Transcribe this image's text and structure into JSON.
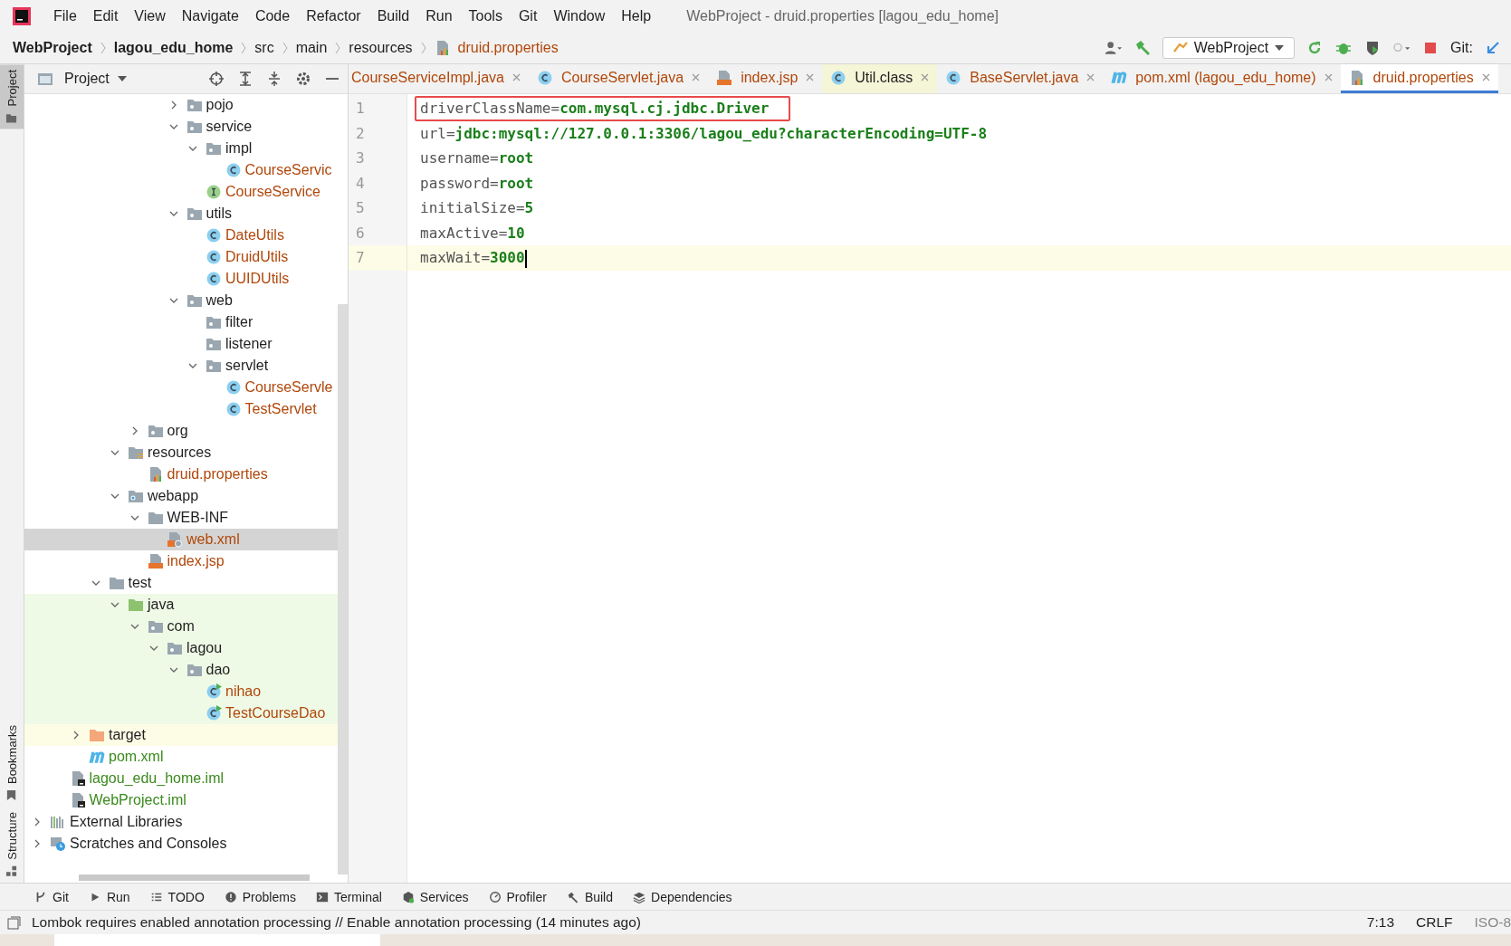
{
  "menu": [
    "File",
    "Edit",
    "View",
    "Navigate",
    "Code",
    "Refactor",
    "Build",
    "Run",
    "Tools",
    "Git",
    "Window",
    "Help"
  ],
  "window": {
    "title": "WebProject - druid.properties [lagou_edu_home]"
  },
  "breadcrumbs": [
    {
      "label": "WebProject",
      "bold": true
    },
    {
      "label": "lagou_edu_home",
      "bold": true
    },
    {
      "label": "src",
      "bold": false
    },
    {
      "label": "main",
      "bold": false
    },
    {
      "label": "resources",
      "bold": false
    },
    {
      "label": "druid.properties",
      "bold": false,
      "kind": "properties",
      "color": "#b0470a"
    }
  ],
  "toolbar": {
    "run_config": "WebProject",
    "git_label": "Git:"
  },
  "side_tabs": [
    {
      "label": "Project",
      "selected": true
    },
    {
      "label": "Bookmarks",
      "selected": false
    },
    {
      "label": "Structure",
      "selected": false
    }
  ],
  "project_panel": {
    "title": "Project"
  },
  "tree": [
    {
      "label": "pojo",
      "kind": "package",
      "expanded": false,
      "selected": false
    },
    {
      "label": "service",
      "kind": "package",
      "expanded": true,
      "selected": false,
      "children": [
        {
          "label": "impl",
          "kind": "package",
          "expanded": true,
          "selected": false,
          "children": [
            {
              "label": "CourseServic",
              "kind": "class",
              "color": "#b0470a",
              "selected": false
            }
          ]
        },
        {
          "label": "CourseService",
          "kind": "interface",
          "color": "#b0470a",
          "selected": false
        }
      ]
    },
    {
      "label": "utils",
      "kind": "package",
      "expanded": true,
      "selected": false,
      "children": [
        {
          "label": "DateUtils",
          "kind": "class",
          "color": "#b0470a",
          "selected": false
        },
        {
          "label": "DruidUtils",
          "kind": "class",
          "color": "#b0470a",
          "selected": false
        },
        {
          "label": "UUIDUtils",
          "kind": "class",
          "color": "#b0470a",
          "selected": false
        }
      ]
    },
    {
      "label": "web",
      "kind": "package",
      "expanded": true,
      "selected": false,
      "children": [
        {
          "label": "filter",
          "kind": "package",
          "selected": false
        },
        {
          "label": "listener",
          "kind": "package",
          "selected": false
        },
        {
          "label": "servlet",
          "kind": "package",
          "expanded": true,
          "selected": false,
          "children": [
            {
              "label": "CourseServle",
              "kind": "class",
              "color": "#b0470a",
              "selected": false
            },
            {
              "label": "TestServlet",
              "kind": "class",
              "color": "#b0470a",
              "selected": false
            }
          ]
        }
      ]
    },
    {
      "label": "org",
      "kind": "package",
      "expanded": false,
      "selected": false
    },
    {
      "label": "resources",
      "kind": "resources",
      "expanded": true,
      "selected": false,
      "children": [
        {
          "label": "druid.properties",
          "kind": "properties",
          "color": "#b0470a",
          "selected": false
        }
      ]
    },
    {
      "label": "webapp",
      "kind": "webapp",
      "expanded": true,
      "selected": false,
      "children": [
        {
          "label": "WEB-INF",
          "kind": "folder",
          "expanded": true,
          "selected": false,
          "children": [
            {
              "label": "web.xml",
              "kind": "xml",
              "color": "#b0470a",
              "selected": true
            }
          ]
        },
        {
          "label": "index.jsp",
          "kind": "jsp",
          "color": "#b0470a",
          "selected": false
        }
      ]
    },
    {
      "label": "test",
      "kind": "folder",
      "expanded": true,
      "selected": false,
      "children": [
        {
          "label": "java",
          "kind": "test-folder",
          "expanded": true,
          "selected": false,
          "test_sources": true,
          "children": [
            {
              "label": "com",
              "kind": "package",
              "expanded": true,
              "selected": false,
              "children": [
                {
                  "label": "lagou",
                  "kind": "package",
                  "expanded": true,
                  "selected": false,
                  "children": [
                    {
                      "label": "dao",
                      "kind": "package",
                      "expanded": true,
                      "selected": false,
                      "children": [
                        {
                          "label": "nihao",
                          "kind": "test-class",
                          "color": "#b0470a",
                          "selected": false
                        },
                        {
                          "label": "TestCourseDao",
                          "kind": "test-class",
                          "color": "#b0470a",
                          "selected": false
                        }
                      ]
                    }
                  ]
                }
              ]
            }
          ]
        }
      ]
    },
    {
      "label": "target",
      "kind": "excluded-folder",
      "expanded": false,
      "selected": false,
      "excluded": true
    },
    {
      "label": "pom.xml",
      "kind": "maven",
      "color": "#3a8a1c",
      "selected": false
    },
    {
      "label": "lagou_edu_home.iml",
      "kind": "iml",
      "color": "#3a8a1c",
      "selected": false
    },
    {
      "label": "WebProject.iml",
      "kind": "iml",
      "color": "#3a8a1c",
      "selected": false
    },
    {
      "label": "External Libraries",
      "kind": "libraries",
      "expanded": false,
      "selected": false
    },
    {
      "label": "Scratches and Consoles",
      "kind": "scratches",
      "expanded": false,
      "selected": false
    }
  ],
  "tabs": [
    {
      "label": "CourseServiceImpl.java",
      "color": "#b0470a",
      "selected": false,
      "library": false
    },
    {
      "label": "CourseServlet.java",
      "kind": "class",
      "color": "#b0470a",
      "selected": false,
      "library": false
    },
    {
      "label": "index.jsp",
      "kind": "jsp",
      "color": "#b0470a",
      "selected": false,
      "library": false
    },
    {
      "label": "Util.class",
      "kind": "class",
      "color": "#1f1f1f",
      "selected": false,
      "library": true
    },
    {
      "label": "BaseServlet.java",
      "kind": "class",
      "color": "#b0470a",
      "selected": false,
      "library": false
    },
    {
      "label": "pom.xml (lagou_edu_home)",
      "kind": "maven",
      "color": "#b0470a",
      "selected": false,
      "library": false
    },
    {
      "label": "druid.properties",
      "kind": "properties",
      "color": "#b0470a",
      "selected": true,
      "library": false
    }
  ],
  "editor": {
    "lines": [
      {
        "number": "1",
        "key": "driverClassName=",
        "value": "com.mysql.cj.jdbc.Driver",
        "boxed": true,
        "current": false
      },
      {
        "number": "2",
        "key": "url=",
        "value": "jdbc:mysql://127.0.0.1:3306/lagou_edu?characterEncoding=UTF-8",
        "boxed": false,
        "current": false
      },
      {
        "number": "3",
        "key": "username=",
        "value": "root",
        "boxed": false,
        "current": false
      },
      {
        "number": "4",
        "key": "password=",
        "value": "root",
        "boxed": false,
        "current": false
      },
      {
        "number": "5",
        "key": "initialSize=",
        "value": "5",
        "boxed": false,
        "current": false
      },
      {
        "number": "6",
        "key": "maxActive=",
        "value": "10",
        "boxed": false,
        "current": false
      },
      {
        "number": "7",
        "key": "maxWait=",
        "value": "3000",
        "boxed": false,
        "current": true
      }
    ]
  },
  "tool_windows": [
    {
      "label": "Git",
      "kind": "branch"
    },
    {
      "label": "Run",
      "kind": "play"
    },
    {
      "label": "TODO",
      "kind": "list"
    },
    {
      "label": "Problems",
      "kind": "alert"
    },
    {
      "label": "Terminal",
      "kind": "terminal"
    },
    {
      "label": "Services",
      "kind": "services"
    },
    {
      "label": "Profiler",
      "kind": "profiler"
    },
    {
      "label": "Build",
      "kind": "hammer"
    },
    {
      "label": "Dependencies",
      "kind": "layers"
    }
  ],
  "status_bar": {
    "message": "Lombok requires enabled annotation processing // Enable annotation processing (14 minutes ago)",
    "position": "7:13",
    "line_separator": "CRLF",
    "encoding": "ISO-8"
  }
}
